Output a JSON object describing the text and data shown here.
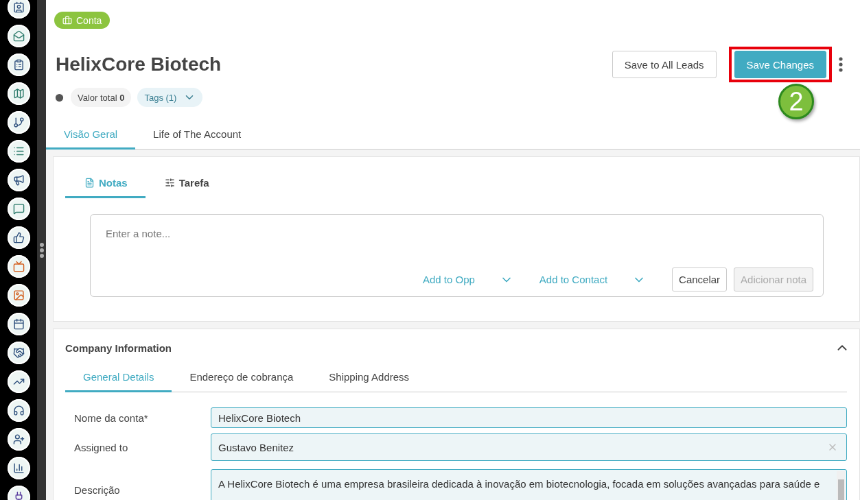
{
  "record_type": {
    "label": "Conta"
  },
  "title": "HelixCore Biotech",
  "actions": [
    {
      "label": "Save to All Leads",
      "kind": "secondary",
      "highlighted": false
    },
    {
      "label": "Save Changes",
      "kind": "primary",
      "highlighted": true
    }
  ],
  "step_badge": "2",
  "meta": {
    "total": "Valor total **0**",
    "tags": "Tags (1)"
  },
  "tabs": [
    {
      "label": "Visão Geral",
      "selected": true
    },
    {
      "label": "Life of The Account",
      "selected": false
    }
  ],
  "notes": {
    "tabs": [
      {
        "label": "Notas",
        "selected": true,
        "kind": "notes"
      },
      {
        "label": "Tarefa",
        "selected": false,
        "kind": "task"
      }
    ],
    "placeholder": "Enter a note...",
    "links": [
      "Add to Opp",
      "Add to Contact"
    ],
    "cancel": "Cancelar",
    "submit": {
      "label": "Adicionar nota",
      "disabled": true
    }
  },
  "company": {
    "title": "Company Information",
    "expanded": true,
    "tabs": [
      {
        "label": "General Details",
        "selected": true
      },
      {
        "label": "Endereço de cobrança",
        "selected": false
      },
      {
        "label": "Shipping Address",
        "selected": false
      }
    ],
    "fields": [
      {
        "label": "Nome da conta*",
        "value": "HelixCore Biotech",
        "kind": "text"
      },
      {
        "label": "Assigned to",
        "value": "Gustavo Benitez",
        "kind": "select"
      },
      {
        "label": "Descrição",
        "value": "A HelixCore Biotech é uma empresa brasileira dedicada à inovação em biotecnologia, focada em soluções avançadas para saúde e",
        "kind": "textarea"
      }
    ]
  }
}
